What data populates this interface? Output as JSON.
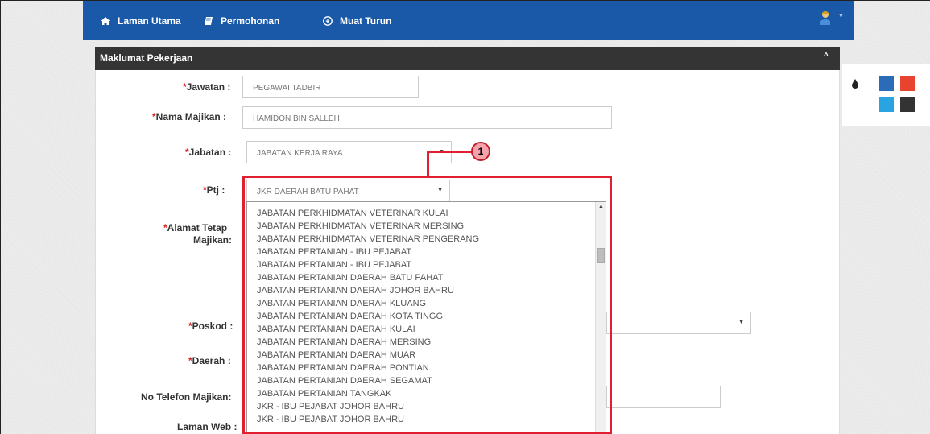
{
  "nav": {
    "items": [
      {
        "label": "Laman Utama",
        "icon": "home-icon"
      },
      {
        "label": "Permohonan",
        "icon": "book-icon"
      },
      {
        "label": "Muat Turun",
        "icon": "download-icon"
      }
    ],
    "bg_color": "#1a58a8"
  },
  "panel": {
    "title": "Maklumat Pekerjaan"
  },
  "form": {
    "required_mark": "*",
    "jawatan": {
      "label": "Jawatan :",
      "value": "PEGAWAI TADBIR"
    },
    "nama_majikan": {
      "label": "Nama Majikan :",
      "value": "HAMIDON BIN SALLEH"
    },
    "jabatan": {
      "label": "Jabatan :",
      "value": "JABATAN KERJA RAYA"
    },
    "ptj": {
      "label": "Ptj :",
      "value": "JKR DAERAH BATU PAHAT"
    },
    "alamat": {
      "label_line1": "Alamat Tetap",
      "label_line2": "Majikan:"
    },
    "poskod": {
      "label": "Poskod :"
    },
    "daerah": {
      "label": "Daerah :"
    },
    "no_telefon": {
      "label": "No Telefon Majikan:"
    },
    "laman_web": {
      "label": "Laman Web :"
    }
  },
  "ptj_options": [
    "JABATAN PERKHIDMATAN VETERINAR KULAI",
    "JABATAN PERKHIDMATAN VETERINAR MERSING",
    "JABATAN PERKHIDMATAN VETERINAR PENGERANG",
    "JABATAN PERTANIAN - IBU PEJABAT",
    "JABATAN PERTANIAN - IBU PEJABAT",
    "JABATAN PERTANIAN DAERAH BATU PAHAT",
    "JABATAN PERTANIAN DAERAH JOHOR BAHRU",
    "JABATAN PERTANIAN DAERAH KLUANG",
    "JABATAN PERTANIAN DAERAH KOTA TINGGI",
    "JABATAN PERTANIAN DAERAH KULAI",
    "JABATAN PERTANIAN DAERAH MERSING",
    "JABATAN PERTANIAN DAERAH MUAR",
    "JABATAN PERTANIAN DAERAH PONTIAN",
    "JABATAN PERTANIAN DAERAH SEGAMAT",
    "JABATAN PERTANIAN TANGKAK",
    "JKR - IBU PEJABAT JOHOR BAHRU",
    "JKR - IBU PEJABAT JOHOR BAHRU"
  ],
  "callout": {
    "number": "1",
    "color": "#e02030"
  },
  "theme_colors": [
    "#2b6cb8",
    "#e8432f",
    "#2aa4e0",
    "#333333"
  ]
}
